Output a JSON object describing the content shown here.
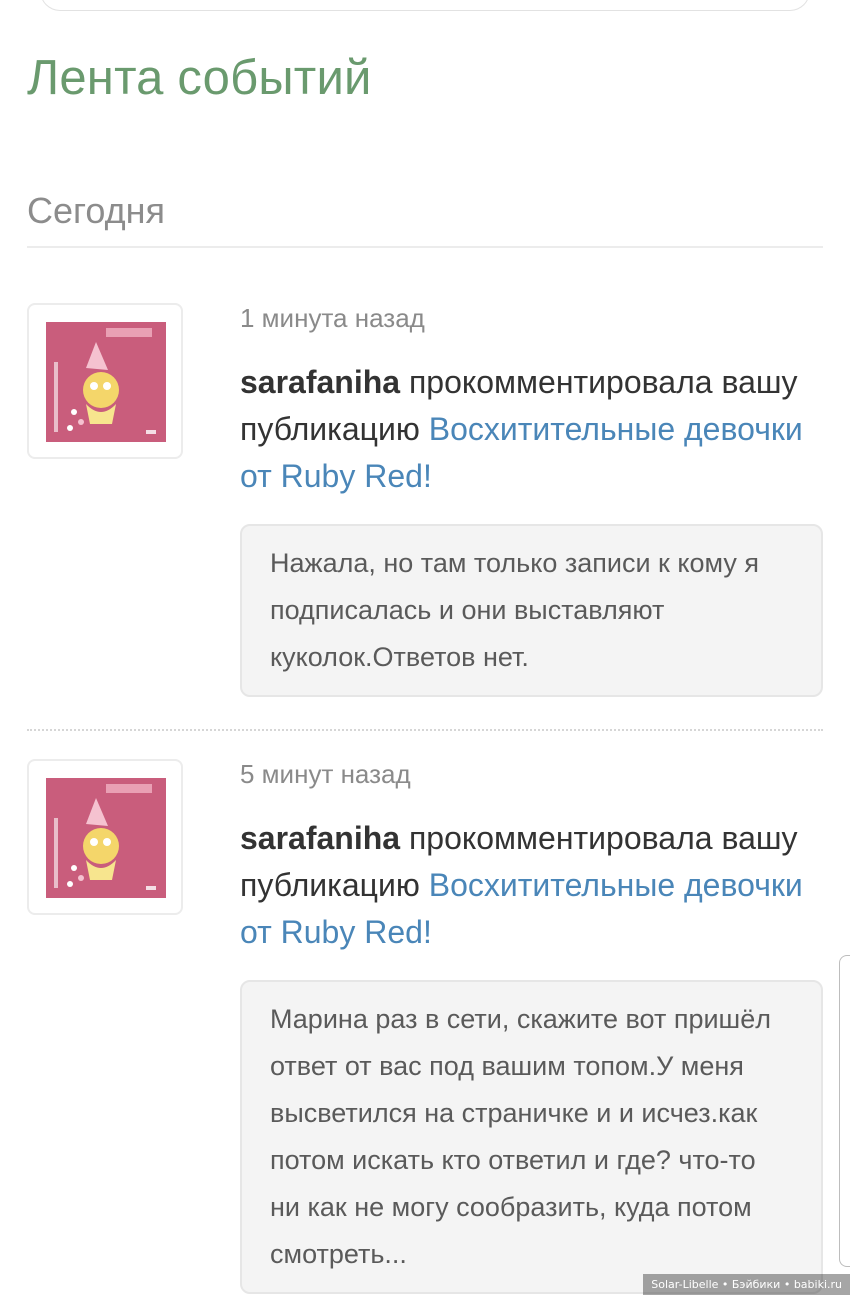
{
  "page": {
    "title": "Лента событий",
    "day_header": "Сегодня"
  },
  "events": [
    {
      "time": "1 минута назад",
      "user": "sarafaniha",
      "action": "прокомментировала вашу публикацию",
      "link": "Восхитительные девочки от Ruby Red!",
      "comment": "Нажала, но там только записи к кому я подписалась и они выставляют куколок.Ответов нет."
    },
    {
      "time": "5 минут назад",
      "user": "sarafaniha",
      "action": "прокомментировала вашу публикацию",
      "link": "Восхитительные девочки от Ruby Red!",
      "comment": "Марина раз в сети, скажите вот пришёл ответ от вас под вашим топом.У меня высветился на страничке и и исчез.как потом искать кто ответил и где? что-то ни как не могу сообразить, куда потом смотреть..."
    }
  ],
  "watermark": "Solar-Libelle • Бэйбики • babiki.ru",
  "colors": {
    "title": "#6a9a6e",
    "link": "#4a86b8",
    "avatar_bg": "#c95d7c"
  }
}
